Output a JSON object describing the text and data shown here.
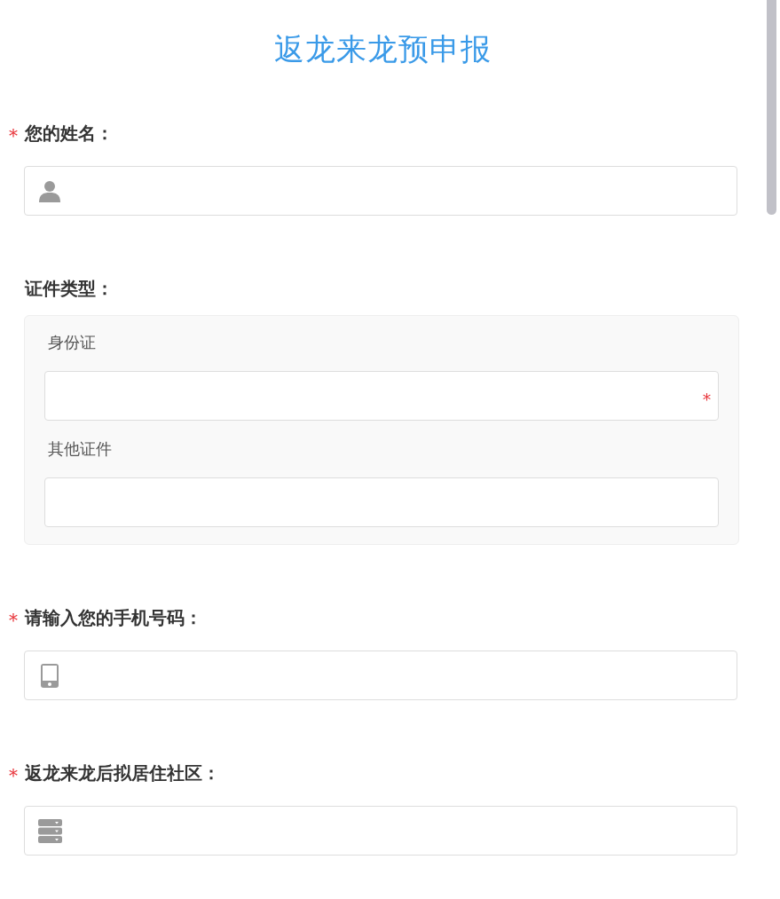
{
  "title": "返龙来龙预申报",
  "questions": [
    {
      "kind": "text",
      "required_mark": "*",
      "label": "您的姓名："
    },
    {
      "kind": "group",
      "label": "证件类型：",
      "options": [
        {
          "label": "身份证",
          "required_mark": "*"
        },
        {
          "label": "其他证件"
        }
      ]
    },
    {
      "kind": "phone",
      "required_mark": "*",
      "label": "请输入您的手机号码："
    },
    {
      "kind": "select",
      "required_mark": "*",
      "label": "返龙来龙后拟居住社区："
    }
  ]
}
